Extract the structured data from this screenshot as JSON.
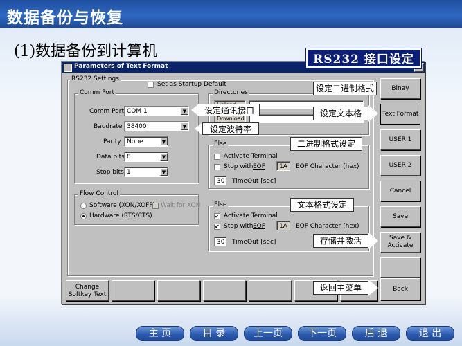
{
  "slide": {
    "title": "数据备份与恢复",
    "subtitle": "(1)数据备份到计算机",
    "rs232_label": "RS232 接口设定"
  },
  "dialog": {
    "title": "Parameters of Text Format",
    "close_icon": "✕",
    "rs232_settings_title": "RS232 Settings",
    "startup_default_label": "Set as Startup Default",
    "comm_port": {
      "group_title": "Comm Port",
      "fields": [
        {
          "label": "Comm Port",
          "value": "COM 1"
        },
        {
          "label": "Baudrate",
          "value": "38400"
        },
        {
          "label": "Parity",
          "value": "None"
        },
        {
          "label": "Data bits",
          "value": "8"
        },
        {
          "label": "Stop bits",
          "value": "1"
        }
      ]
    },
    "flow_control": {
      "group_title": "Flow Control",
      "software_label": "Software (XON/XOFF)",
      "wait_label": "Wait for XON",
      "hardware_label": "Hardware (RTS/CTS)",
      "selected": "hardware"
    },
    "directories": {
      "group_title": "Directories",
      "upload_label": "Upload",
      "download_label": "Download"
    },
    "else_top": {
      "group_title": "Else",
      "activate_label": "Activate Terminal",
      "activate_checked": false,
      "stop_label": "Stop with",
      "eof_label": "EOF",
      "stop_checked": false,
      "eof_value": "1A",
      "eof_char_label": "EOF Character (hex)",
      "timeout_value": "30",
      "timeout_label": "TimeOut [sec]"
    },
    "else_bottom": {
      "group_title": "Else",
      "activate_label": "Activate Terminal",
      "activate_checked": true,
      "stop_label": "Stop with",
      "eof_label": "EOF",
      "stop_checked": true,
      "eof_value": "1A",
      "eof_char_label": "EOF Character (hex)",
      "timeout_value": "30",
      "timeout_label": "TimeOut [sec]"
    },
    "side_buttons": {
      "binary_format": "Binay Format",
      "text_format": "Text Format",
      "user1": "USER 1",
      "user2": "USER 2",
      "cancel": "Cancel",
      "save": "Save",
      "save_activate_line1": "Save &",
      "save_activate_line2": "Activate",
      "back": "Back"
    },
    "softkey": {
      "change_line1": "Change",
      "change_line2": "Softkey Text"
    }
  },
  "callouts": {
    "binary_format": "设定二进制格式",
    "comm_port": "设定通讯接口",
    "baudrate": "设定波特率",
    "text_format": "设定文本格",
    "binary_format_setting": "二进制格式设定",
    "text_format_setting": "文本格式设定",
    "save_activate": "存储并激活",
    "back_main": "返回主菜单"
  },
  "nav": {
    "home": "主 页",
    "toc": "目 录",
    "prev": "上一页",
    "next": "下一页",
    "back": "后 退",
    "exit": "退 出"
  },
  "colors": {
    "title_bar": "#2e68c2",
    "dialog_title": "#0a246a",
    "rs232_label_bg": "#0b1f78",
    "nav_button": "#2b5bb0"
  }
}
